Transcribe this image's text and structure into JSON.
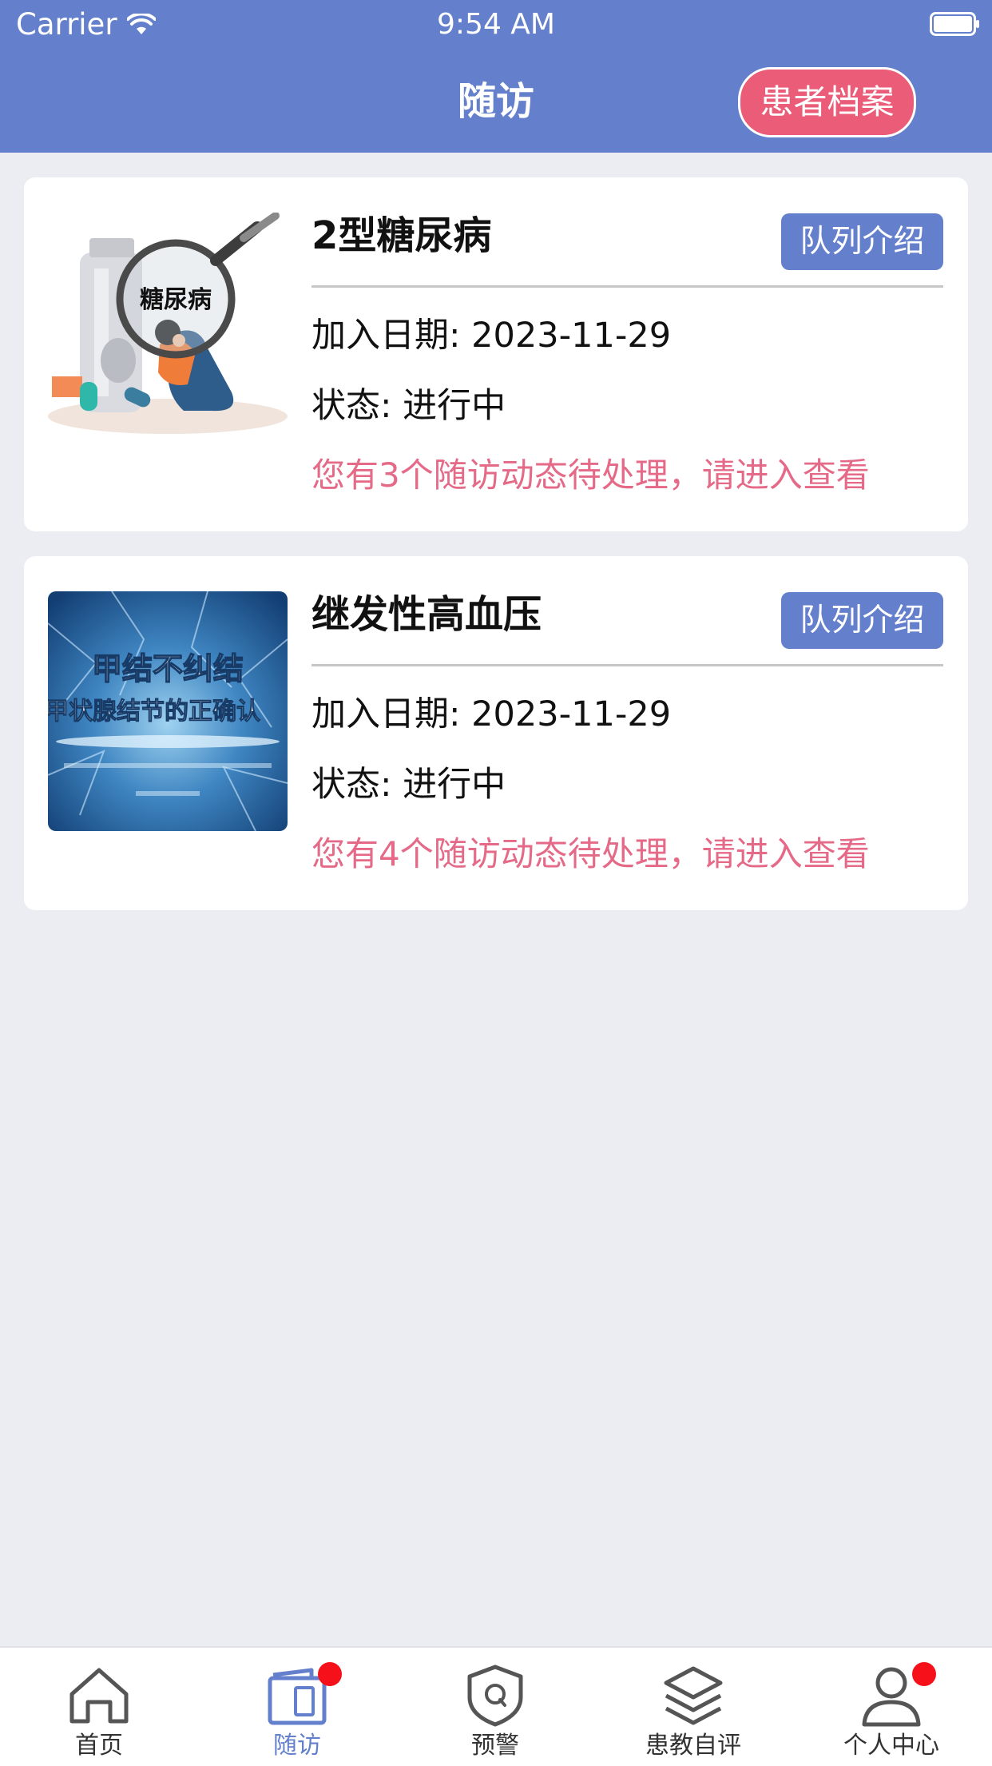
{
  "status_bar": {
    "carrier": "Carrier",
    "time": "9:54 AM"
  },
  "header": {
    "title": "随访",
    "archive_button": "患者档案",
    "background": "#6480cc",
    "archive_color": "#ea5c78"
  },
  "cohorts": [
    {
      "title": "2型糖尿病",
      "intro_button": "队列介绍",
      "join_date": "加入日期: 2023-11-29",
      "status": "状态: 进行中",
      "alert": "您有3个随访动态待处理，请进入查看",
      "thumb_text": "糖尿病",
      "thumb_icon": "diabetes-magnifier-illustration"
    },
    {
      "title": "继发性高血压",
      "intro_button": "队列介绍",
      "join_date": "加入日期: 2023-11-29",
      "status": "状态: 进行中",
      "alert": "您有4个随访动态待处理，请进入查看",
      "thumb_text": "甲结不纠结",
      "thumb_subtitle": "甲状腺结节的正确认",
      "thumb_icon": "thyroid-video-cover"
    }
  ],
  "tabbar": {
    "items": [
      {
        "label": "首页",
        "icon": "home-icon",
        "active": false,
        "badge": false
      },
      {
        "label": "随访",
        "icon": "followup-icon",
        "active": true,
        "badge": true
      },
      {
        "label": "预警",
        "icon": "shield-alert-icon",
        "active": false,
        "badge": false
      },
      {
        "label": "患教自评",
        "icon": "layers-icon",
        "active": false,
        "badge": false
      },
      {
        "label": "个人中心",
        "icon": "person-icon",
        "active": false,
        "badge": true
      }
    ],
    "active_color": "#6480cc",
    "badge_color": "#f5101a"
  }
}
